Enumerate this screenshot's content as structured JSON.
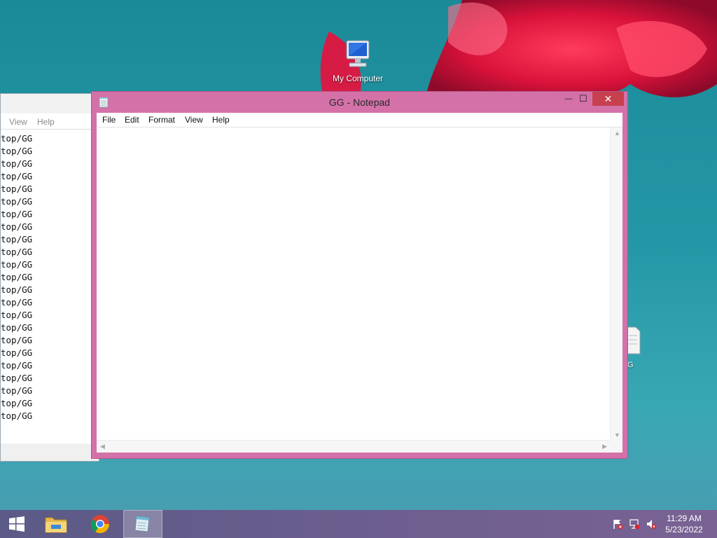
{
  "desktop": {
    "icons": [
      {
        "label": "My Computer"
      },
      {
        "label": "G"
      }
    ]
  },
  "background_window": {
    "menu": [
      "View",
      "Help"
    ],
    "lines": [
      "top/GG",
      "top/GG",
      "top/GG",
      "top/GG",
      "top/GG",
      "top/GG",
      "top/GG",
      "top/GG",
      "top/GG",
      "top/GG",
      "top/GG",
      "top/GG",
      "top/GG",
      "top/GG",
      "top/GG",
      "top/GG",
      "top/GG",
      "top/GG",
      "top/GG",
      "top/GG",
      "top/GG",
      "top/GG",
      "top/GG"
    ]
  },
  "notepad": {
    "title": "GG - Notepad",
    "menu": [
      "File",
      "Edit",
      "Format",
      "View",
      "Help"
    ],
    "controls": {
      "minimize": "—",
      "maximize": "☐",
      "close": "✕"
    },
    "text": ""
  },
  "taskbar": {
    "time": "11:29 AM",
    "date": "5/23/2022"
  },
  "colors": {
    "notepad_frame": "#d471a8",
    "close_button": "#c7404e",
    "taskbar": "#6b5e8e"
  }
}
